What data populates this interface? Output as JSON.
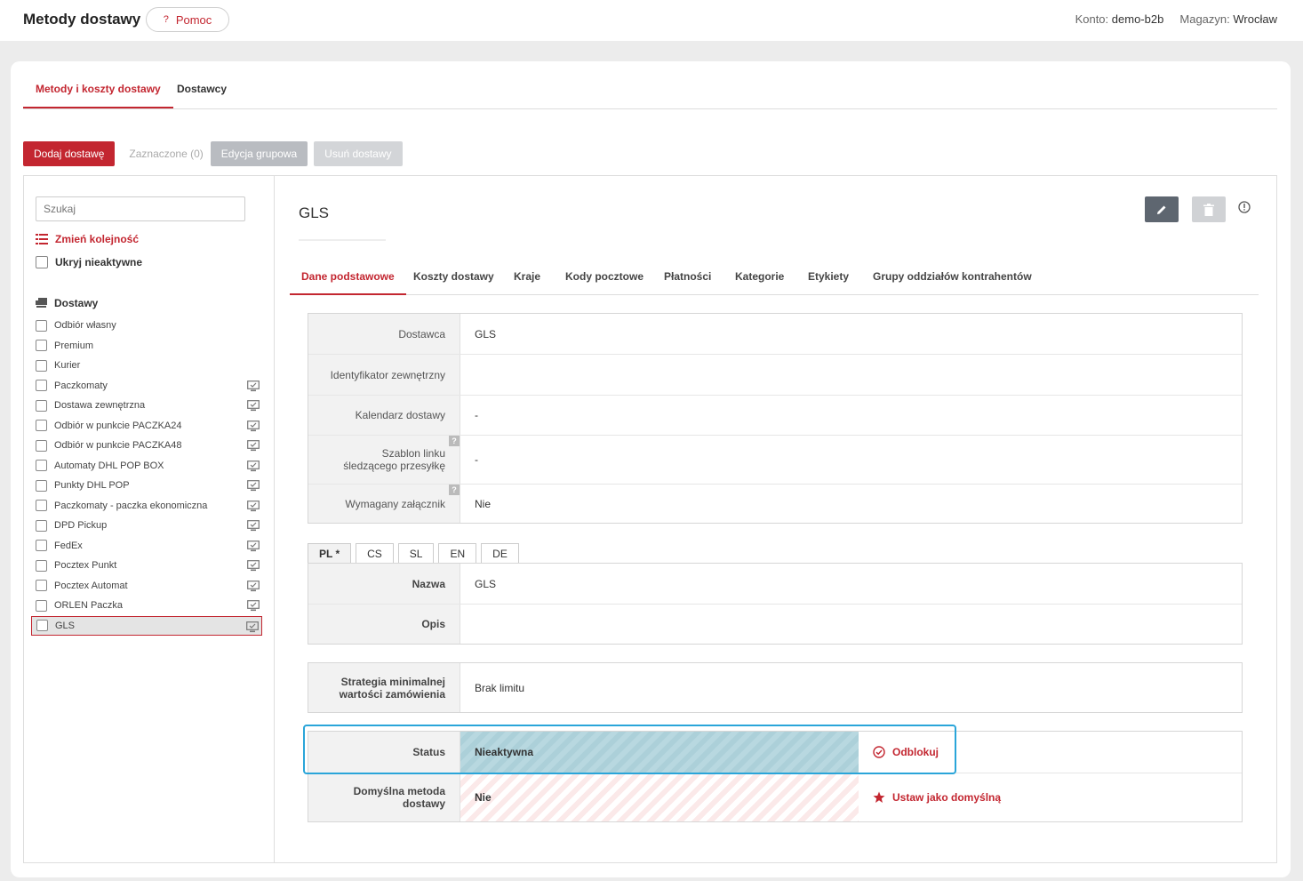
{
  "header": {
    "title": "Metody dostawy",
    "help_label": "Pomoc",
    "help_icon": "?",
    "account_label": "Konto:",
    "account_value": "demo-b2b",
    "warehouse_label": "Magazyn:",
    "warehouse_value": "Wrocław"
  },
  "main_tabs": [
    {
      "label": "Metody i koszty dostawy",
      "active": true
    },
    {
      "label": "Dostawcy",
      "active": false
    }
  ],
  "actions": {
    "add_label": "Dodaj dostawę",
    "selected_label": "Zaznaczone (0)",
    "group_edit_label": "Edycja grupowa",
    "delete_label": "Usuń dostawy"
  },
  "sidebar": {
    "search_placeholder": "Szukaj",
    "reorder_label": "Zmień kolejność",
    "hide_inactive_label": "Ukryj nieaktywne",
    "section_label": "Dostawy",
    "items": [
      {
        "label": "Odbiór własny",
        "monitor": false
      },
      {
        "label": "Premium",
        "monitor": false
      },
      {
        "label": "Kurier",
        "monitor": false
      },
      {
        "label": "Paczkomaty",
        "monitor": true
      },
      {
        "label": "Dostawa zewnętrzna",
        "monitor": true
      },
      {
        "label": "Odbiór w punkcie PACZKA24",
        "monitor": true
      },
      {
        "label": "Odbiór w punkcie PACZKA48",
        "monitor": true
      },
      {
        "label": "Automaty DHL POP BOX",
        "monitor": true
      },
      {
        "label": "Punkty DHL POP",
        "monitor": true
      },
      {
        "label": "Paczkomaty - paczka ekonomiczna",
        "monitor": true
      },
      {
        "label": "DPD Pickup",
        "monitor": true
      },
      {
        "label": "FedEx",
        "monitor": true
      },
      {
        "label": "Pocztex Punkt",
        "monitor": true
      },
      {
        "label": "Pocztex Automat",
        "monitor": true
      },
      {
        "label": "ORLEN Paczka",
        "monitor": true
      },
      {
        "label": "GLS",
        "monitor": true,
        "selected": true
      }
    ]
  },
  "detail": {
    "title": "GLS",
    "sub_tabs": [
      {
        "label": "Dane podstawowe",
        "active": true
      },
      {
        "label": "Koszty dostawy"
      },
      {
        "label": "Kraje"
      },
      {
        "label": "Kody pocztowe"
      },
      {
        "label": "Płatności"
      },
      {
        "label": "Kategorie"
      },
      {
        "label": "Etykiety"
      },
      {
        "label": "Grupy oddziałów kontrahentów"
      }
    ],
    "basic": {
      "supplier_label": "Dostawca",
      "supplier_value": "GLS",
      "external_id_label": "Identyfikator zewnętrzny",
      "external_id_value": "",
      "calendar_label": "Kalendarz dostawy",
      "calendar_value": "-",
      "tracking_label": "Szablon linku śledzącego przesyłkę",
      "tracking_value": "-",
      "attachment_label": "Wymagany załącznik",
      "attachment_value": "Nie",
      "help_mark": "?"
    },
    "languages": [
      "PL *",
      "CS",
      "SL",
      "EN",
      "DE"
    ],
    "lang": {
      "name_label": "Nazwa",
      "name_value": "GLS",
      "desc_label": "Opis",
      "desc_value": ""
    },
    "min_order": {
      "label": "Strategia minimalnej wartości zamówienia",
      "value": "Brak limitu"
    },
    "status": {
      "label": "Status",
      "value": "Nieaktywna",
      "action_label": "Odblokuj"
    },
    "default_method": {
      "label": "Domyślna metoda dostawy",
      "value": "Nie",
      "action_label": "Ustaw jako domyślną"
    }
  },
  "colors": {
    "accent": "#c32630",
    "highlight": "#2aa5d9"
  }
}
